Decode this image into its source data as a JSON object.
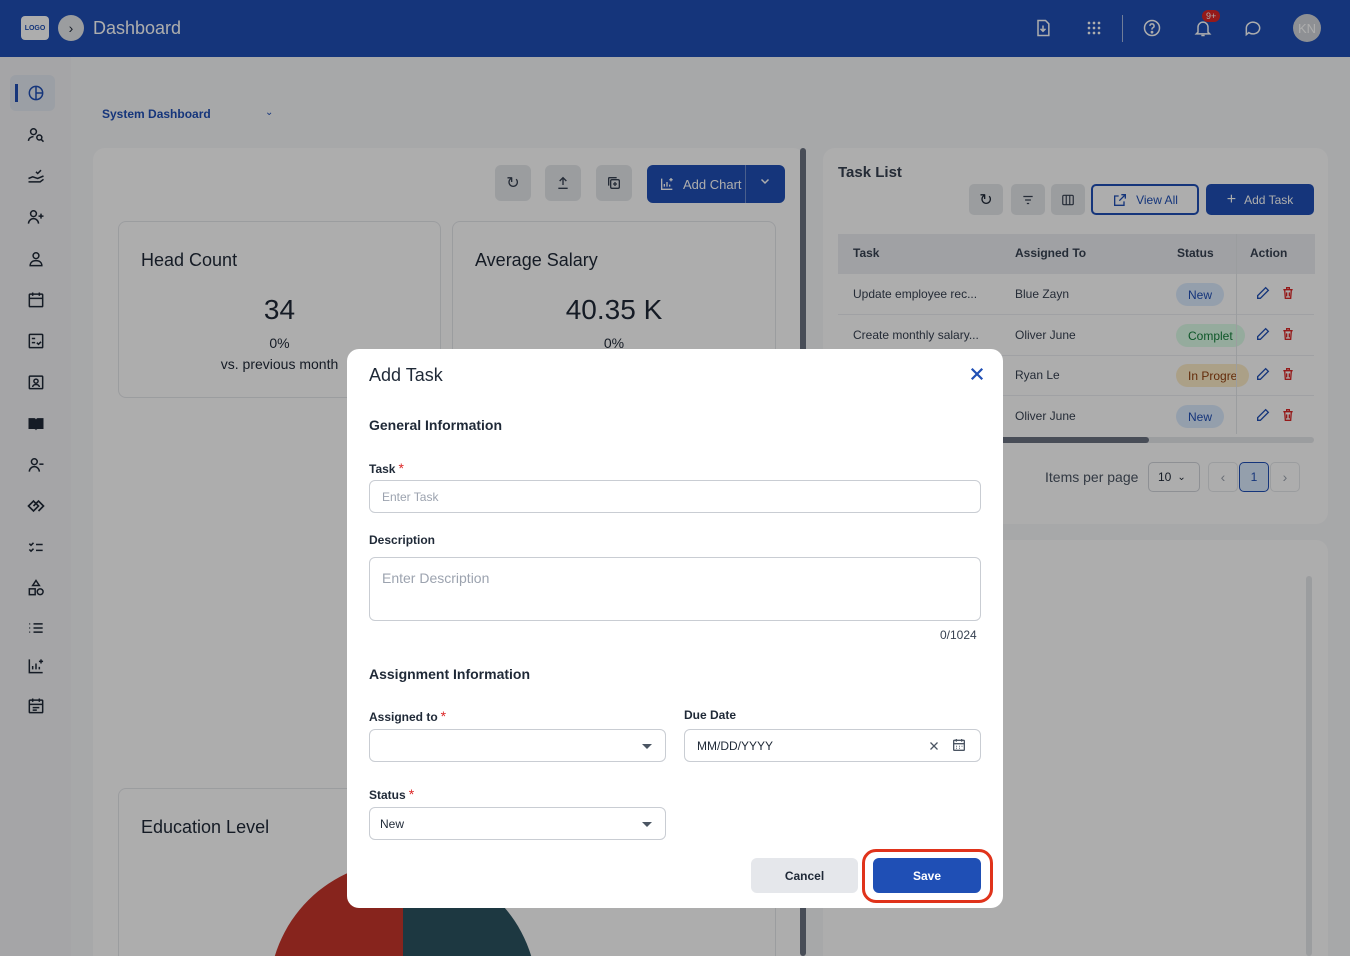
{
  "header": {
    "logo_text": "LOGO",
    "title": "Dashboard",
    "notification_count": "9+",
    "avatar_initials": "KN"
  },
  "dashboard": {
    "selector_label": "System Dashboard",
    "add_chart_label": "Add Chart"
  },
  "cards": {
    "head_count": {
      "title": "Head Count",
      "value": "34",
      "pct": "0%",
      "vs": "vs. previous month"
    },
    "average_salary": {
      "title": "Average Salary",
      "value": "40.35 K",
      "pct": "0%"
    },
    "education": {
      "title": "Education Level"
    }
  },
  "task_list": {
    "title": "Task List",
    "view_all_label": "View All",
    "add_task_label": "Add Task",
    "columns": [
      "Task",
      "Assigned To",
      "Status",
      "Action"
    ],
    "rows": [
      {
        "task": "Update employee rec...",
        "assigned": "Blue Zayn",
        "status": "New"
      },
      {
        "task": "Create monthly salary...",
        "assigned": "Oliver June",
        "status": "Complet"
      },
      {
        "task": "",
        "assigned": "Ryan Le",
        "status": "In Progre"
      },
      {
        "task": "",
        "assigned": "Oliver June",
        "status": "New"
      }
    ],
    "items_per_page_label": "Items per page",
    "items_per_page_value": "10",
    "current_page": "1"
  },
  "modal": {
    "title": "Add Task",
    "general_section": "General Information",
    "task_label": "Task",
    "task_placeholder": "Enter Task",
    "description_label": "Description",
    "description_placeholder": "Enter Description",
    "description_counter": "0/1024",
    "assignment_section": "Assignment Information",
    "assigned_label": "Assigned to",
    "assigned_value": "",
    "due_date_label": "Due Date",
    "due_date_value": "MM/DD/YYYY",
    "status_label": "Status",
    "status_value": "New",
    "required_mark": "*",
    "cancel_label": "Cancel",
    "save_label": "Save"
  },
  "colors": {
    "primary": "#1f4fb5",
    "highlight": "#e0331b",
    "required": "#dc2626"
  }
}
